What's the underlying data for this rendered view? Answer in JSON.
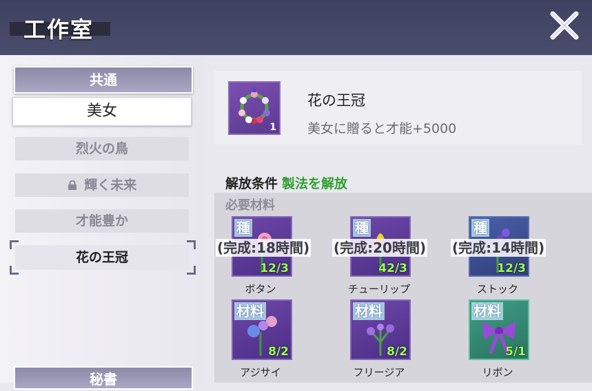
{
  "header": {
    "title": "工作室"
  },
  "sidebar": {
    "tab_common": "共通",
    "tab_beauty": "美女",
    "items": [
      {
        "label": "烈火の鳥",
        "locked": false,
        "active": false
      },
      {
        "label": "輝く未来",
        "locked": true,
        "active": false
      },
      {
        "label": "才能豊か",
        "locked": false,
        "active": false
      },
      {
        "label": "花の王冠",
        "locked": false,
        "active": true
      }
    ],
    "tab_secretary": "秘書"
  },
  "item": {
    "name": "花の王冠",
    "description": "美女に贈ると才能+5000",
    "count": "1"
  },
  "unlock": {
    "label": "解放条件",
    "value": "製法を解放"
  },
  "materials": {
    "heading": "必要材料",
    "list": [
      {
        "tag": "種",
        "time": "(完成:18時間)",
        "count": "12/3",
        "name": "ボタン",
        "color": "purple"
      },
      {
        "tag": "種",
        "time": "(完成:20時間)",
        "count": "42/3",
        "name": "チューリップ",
        "color": "purple"
      },
      {
        "tag": "種",
        "time": "(完成:14時間)",
        "count": "12/3",
        "name": "ストック",
        "color": "blue"
      },
      {
        "tag": "材料",
        "time": "",
        "count": "8/2",
        "name": "アジサイ",
        "color": "purple"
      },
      {
        "tag": "材料",
        "time": "",
        "count": "8/2",
        "name": "フリージア",
        "color": "purple"
      },
      {
        "tag": "材料",
        "time": "",
        "count": "5/1",
        "name": "リボン",
        "color": "green"
      }
    ]
  },
  "icons": {
    "close": "close-icon",
    "lock": "lock-icon",
    "item": "flower-crown-icon"
  },
  "colors": {
    "header_bg": "#3f4160",
    "unlock_green": "#2ea02e",
    "count_green": "#9cff5a"
  }
}
